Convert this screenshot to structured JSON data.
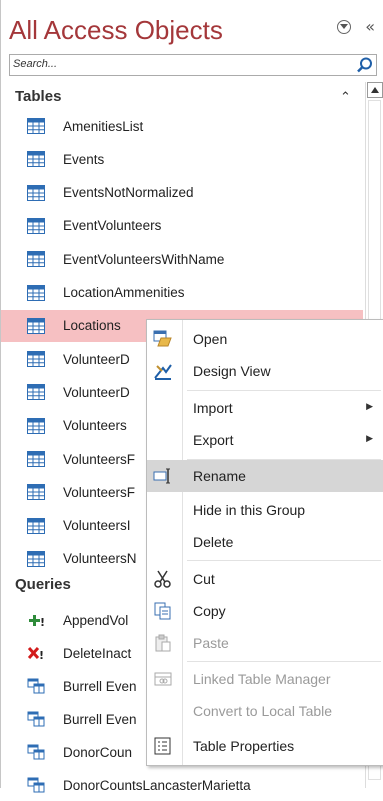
{
  "pane": {
    "title": "All Access Objects",
    "search_placeholder": "Search...",
    "accent_color": "#a4373a",
    "selection_color": "#f6c0c2"
  },
  "groups": {
    "tables": "Tables",
    "queries": "Queries"
  },
  "tables": [
    "AmenitiesList",
    "Events",
    "EventsNotNormalized",
    "EventVolunteers",
    "EventVolunteersWithName",
    "LocationAmmenities",
    "Locations",
    "VolunteerD",
    "VolunteerD",
    "Volunteers",
    "VolunteersF",
    "VolunteersF",
    "VolunteersI",
    "VolunteersN"
  ],
  "queries": [
    {
      "label": "AppendVol",
      "icon": "append-query-icon"
    },
    {
      "label": "DeleteInact",
      "icon": "delete-query-icon"
    },
    {
      "label": "Burrell Even",
      "icon": "select-query-icon"
    },
    {
      "label": "Burrell Even",
      "icon": "select-query-icon"
    },
    {
      "label": "DonorCoun",
      "icon": "select-query-icon"
    },
    {
      "label": "DonorCountsLancasterMarietta",
      "icon": "select-query-icon"
    }
  ],
  "context_menu": {
    "open": "Open",
    "design_view": "Design View",
    "import": "Import",
    "export": "Export",
    "rename": "Rename",
    "hide_in_group": "Hide in this Group",
    "delete": "Delete",
    "cut": "Cut",
    "copy": "Copy",
    "paste": "Paste",
    "linked_table_manager": "Linked Table Manager",
    "convert_to_local": "Convert to Local Table",
    "table_properties": "Table Properties"
  }
}
